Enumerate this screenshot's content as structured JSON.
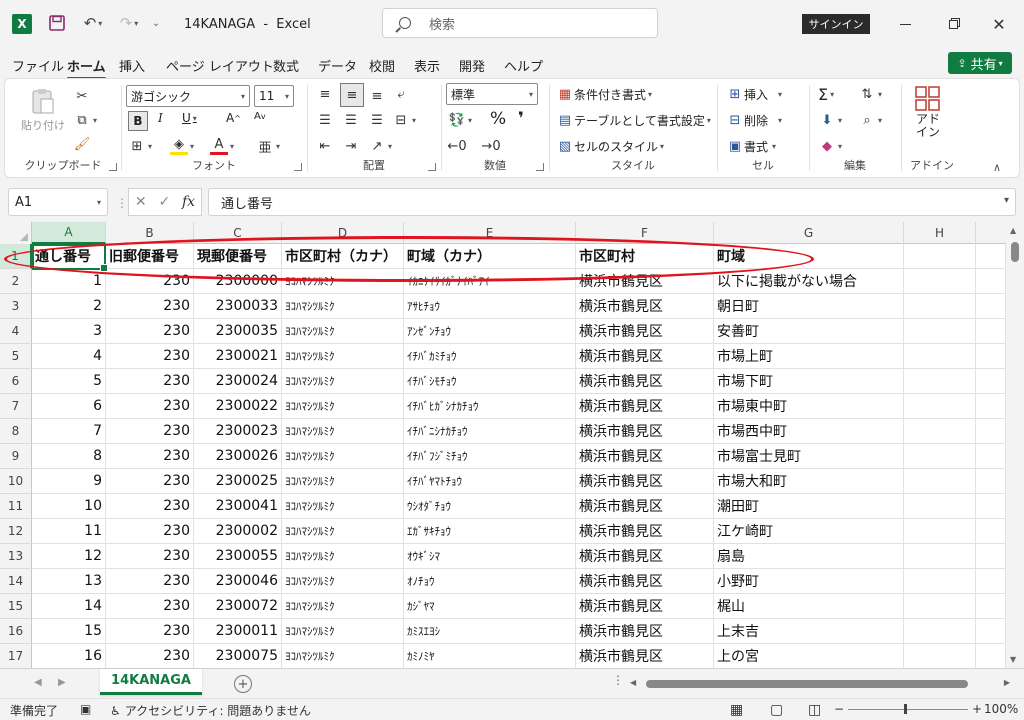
{
  "titlebar": {
    "app_logo": "X",
    "title": "14KANAGA  -  Excel",
    "search_placeholder": "検索",
    "signin": "サインイン",
    "close": "✕"
  },
  "menu": {
    "tabs": [
      "ファイル",
      "ホーム",
      "挿入",
      "ページ レイアウト",
      "数式",
      "データ",
      "校閲",
      "表示",
      "開発",
      "ヘルプ"
    ],
    "share": "共有"
  },
  "ribbon": {
    "clipboard": {
      "label": "クリップボード",
      "paste": "貼り付け"
    },
    "font": {
      "label": "フォント",
      "family": "游ゴシック",
      "size": "11",
      "bold": "B",
      "italic": "I",
      "underline": "U",
      "grow": "A",
      "shrink": "A",
      "color_a": "A"
    },
    "alignment": {
      "label": "配置"
    },
    "number": {
      "label": "数値",
      "format": "標準"
    },
    "styles": {
      "label": "スタイル",
      "conditional": "条件付き書式",
      "as_table": "テーブルとして書式設定",
      "cell_styles": "セルのスタイル"
    },
    "cells": {
      "label": "セル",
      "insert": "挿入",
      "delete": "削除",
      "format": "書式"
    },
    "editing": {
      "label": "編集"
    },
    "addins": {
      "label": "アドイン",
      "button": "アド\nイン"
    }
  },
  "formula_bar": {
    "name_box": "A1",
    "fx": "fx",
    "content": "通し番号"
  },
  "columns": [
    "A",
    "B",
    "C",
    "D",
    "E",
    "F",
    "G",
    "H"
  ],
  "header_row": [
    "通し番号",
    "旧郵便番号",
    "現郵便番号",
    "市区町村（カナ）",
    "町域（カナ）",
    "市区町村",
    "町域"
  ],
  "rows": [
    {
      "n": "2",
      "a": "1",
      "b": "230",
      "c": "2300000",
      "d": "ﾖｺﾊﾏｼﾂﾙﾐｸ",
      "e": "ｲｶﾆｹｲｻｲｶﾞﾅｲﾊﾞｱｲ",
      "f": "横浜市鶴見区",
      "g": "以下に掲載がない場合"
    },
    {
      "n": "3",
      "a": "2",
      "b": "230",
      "c": "2300033",
      "d": "ﾖｺﾊﾏｼﾂﾙﾐｸ",
      "e": "ｱｻﾋﾁｮｳ",
      "f": "横浜市鶴見区",
      "g": "朝日町"
    },
    {
      "n": "4",
      "a": "3",
      "b": "230",
      "c": "2300035",
      "d": "ﾖｺﾊﾏｼﾂﾙﾐｸ",
      "e": "ｱﾝｾﾞﾝﾁｮｳ",
      "f": "横浜市鶴見区",
      "g": "安善町"
    },
    {
      "n": "5",
      "a": "4",
      "b": "230",
      "c": "2300021",
      "d": "ﾖｺﾊﾏｼﾂﾙﾐｸ",
      "e": "ｲﾁﾊﾞｶﾐﾁｮｳ",
      "f": "横浜市鶴見区",
      "g": "市場上町"
    },
    {
      "n": "6",
      "a": "5",
      "b": "230",
      "c": "2300024",
      "d": "ﾖｺﾊﾏｼﾂﾙﾐｸ",
      "e": "ｲﾁﾊﾞｼﾓﾁｮｳ",
      "f": "横浜市鶴見区",
      "g": "市場下町"
    },
    {
      "n": "7",
      "a": "6",
      "b": "230",
      "c": "2300022",
      "d": "ﾖｺﾊﾏｼﾂﾙﾐｸ",
      "e": "ｲﾁﾊﾞﾋｶﾞｼﾅｶﾁｮｳ",
      "f": "横浜市鶴見区",
      "g": "市場東中町"
    },
    {
      "n": "8",
      "a": "7",
      "b": "230",
      "c": "2300023",
      "d": "ﾖｺﾊﾏｼﾂﾙﾐｸ",
      "e": "ｲﾁﾊﾞﾆｼﾅｶﾁｮｳ",
      "f": "横浜市鶴見区",
      "g": "市場西中町"
    },
    {
      "n": "9",
      "a": "8",
      "b": "230",
      "c": "2300026",
      "d": "ﾖｺﾊﾏｼﾂﾙﾐｸ",
      "e": "ｲﾁﾊﾞﾌｼﾞﾐﾁｮｳ",
      "f": "横浜市鶴見区",
      "g": "市場富士見町"
    },
    {
      "n": "10",
      "a": "9",
      "b": "230",
      "c": "2300025",
      "d": "ﾖｺﾊﾏｼﾂﾙﾐｸ",
      "e": "ｲﾁﾊﾞﾔﾏﾄﾁｮｳ",
      "f": "横浜市鶴見区",
      "g": "市場大和町"
    },
    {
      "n": "11",
      "a": "10",
      "b": "230",
      "c": "2300041",
      "d": "ﾖｺﾊﾏｼﾂﾙﾐｸ",
      "e": "ｳｼｵﾀﾞﾁｮｳ",
      "f": "横浜市鶴見区",
      "g": "潮田町"
    },
    {
      "n": "12",
      "a": "11",
      "b": "230",
      "c": "2300002",
      "d": "ﾖｺﾊﾏｼﾂﾙﾐｸ",
      "e": "ｴｶﾞｻｷﾁｮｳ",
      "f": "横浜市鶴見区",
      "g": "江ケ崎町"
    },
    {
      "n": "13",
      "a": "12",
      "b": "230",
      "c": "2300055",
      "d": "ﾖｺﾊﾏｼﾂﾙﾐｸ",
      "e": "ｵｳｷﾞｼﾏ",
      "f": "横浜市鶴見区",
      "g": "扇島"
    },
    {
      "n": "14",
      "a": "13",
      "b": "230",
      "c": "2300046",
      "d": "ﾖｺﾊﾏｼﾂﾙﾐｸ",
      "e": "ｵﾉﾁｮｳ",
      "f": "横浜市鶴見区",
      "g": "小野町"
    },
    {
      "n": "15",
      "a": "14",
      "b": "230",
      "c": "2300072",
      "d": "ﾖｺﾊﾏｼﾂﾙﾐｸ",
      "e": "ｶｼﾞﾔﾏ",
      "f": "横浜市鶴見区",
      "g": "梶山"
    },
    {
      "n": "16",
      "a": "15",
      "b": "230",
      "c": "2300011",
      "d": "ﾖｺﾊﾏｼﾂﾙﾐｸ",
      "e": "ｶﾐｽｴﾖｼ",
      "f": "横浜市鶴見区",
      "g": "上末吉"
    },
    {
      "n": "17",
      "a": "16",
      "b": "230",
      "c": "2300075",
      "d": "ﾖｺﾊﾏｼﾂﾙﾐｸ",
      "e": "ｶﾐﾉﾐﾔ",
      "f": "横浜市鶴見区",
      "g": "上の宮"
    }
  ],
  "sheets": {
    "active": "14KANAGA"
  },
  "status": {
    "ready": "準備完了",
    "accessibility": "アクセシビリティ: 問題ありません",
    "zoom": "100%"
  },
  "colors": {
    "accent": "#107c41",
    "annotation": "#e0141e"
  }
}
